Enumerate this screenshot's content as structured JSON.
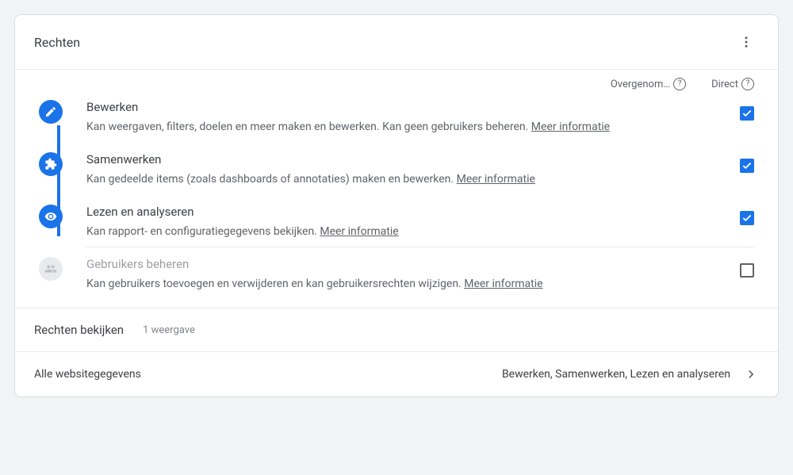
{
  "header": {
    "title": "Rechten"
  },
  "columns": {
    "inherited": "Overgenom…",
    "direct": "Direct"
  },
  "permissions": {
    "0": {
      "title": "Bewerken",
      "desc": "Kan weergaven, filters, doelen en meer maken en bewerken. Kan geen gebruikers beheren. ",
      "more": "Meer informatie"
    },
    "1": {
      "title": "Samenwerken",
      "desc": "Kan gedeelde items (zoals dashboards of annotaties) maken en bewerken. ",
      "more": "Meer informatie"
    },
    "2": {
      "title": "Lezen en analyseren",
      "desc": "Kan rapport- en configuratiegegevens bekijken. ",
      "more": "Meer informatie"
    },
    "3": {
      "title": "Gebruikers beheren",
      "desc": "Kan gebruikers toevoegen en verwijderen en kan gebruikersrechten wijzigen. ",
      "more": "Meer informatie"
    }
  },
  "viewSection": {
    "title": "Rechten bekijken",
    "count": "1 weergave"
  },
  "views": {
    "0": {
      "name": "Alle websitegegevens",
      "perms": "Bewerken, Samenwerken, Lezen en analyseren"
    }
  }
}
